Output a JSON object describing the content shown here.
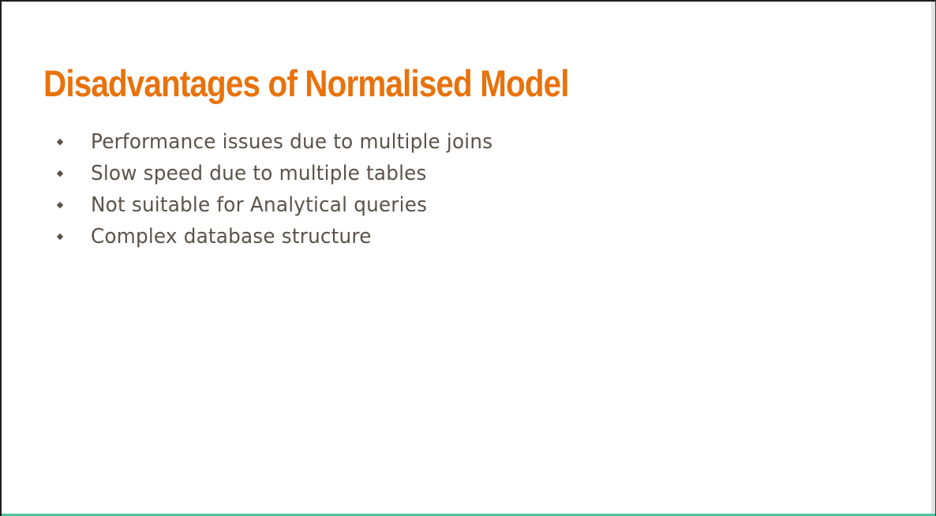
{
  "slide": {
    "title": "Disadvantages of Normalised Model",
    "bullets": [
      "Performance issues due to multiple joins",
      "Slow speed due to multiple tables",
      "Not suitable for Analytical queries",
      "Complex database structure"
    ],
    "bullet_icon": "diamond-bullet-icon"
  },
  "colors": {
    "title": "#e8720c",
    "body_text": "#5b5349",
    "bottom_edge": "#4fc3a0",
    "background": "#ffffff"
  }
}
